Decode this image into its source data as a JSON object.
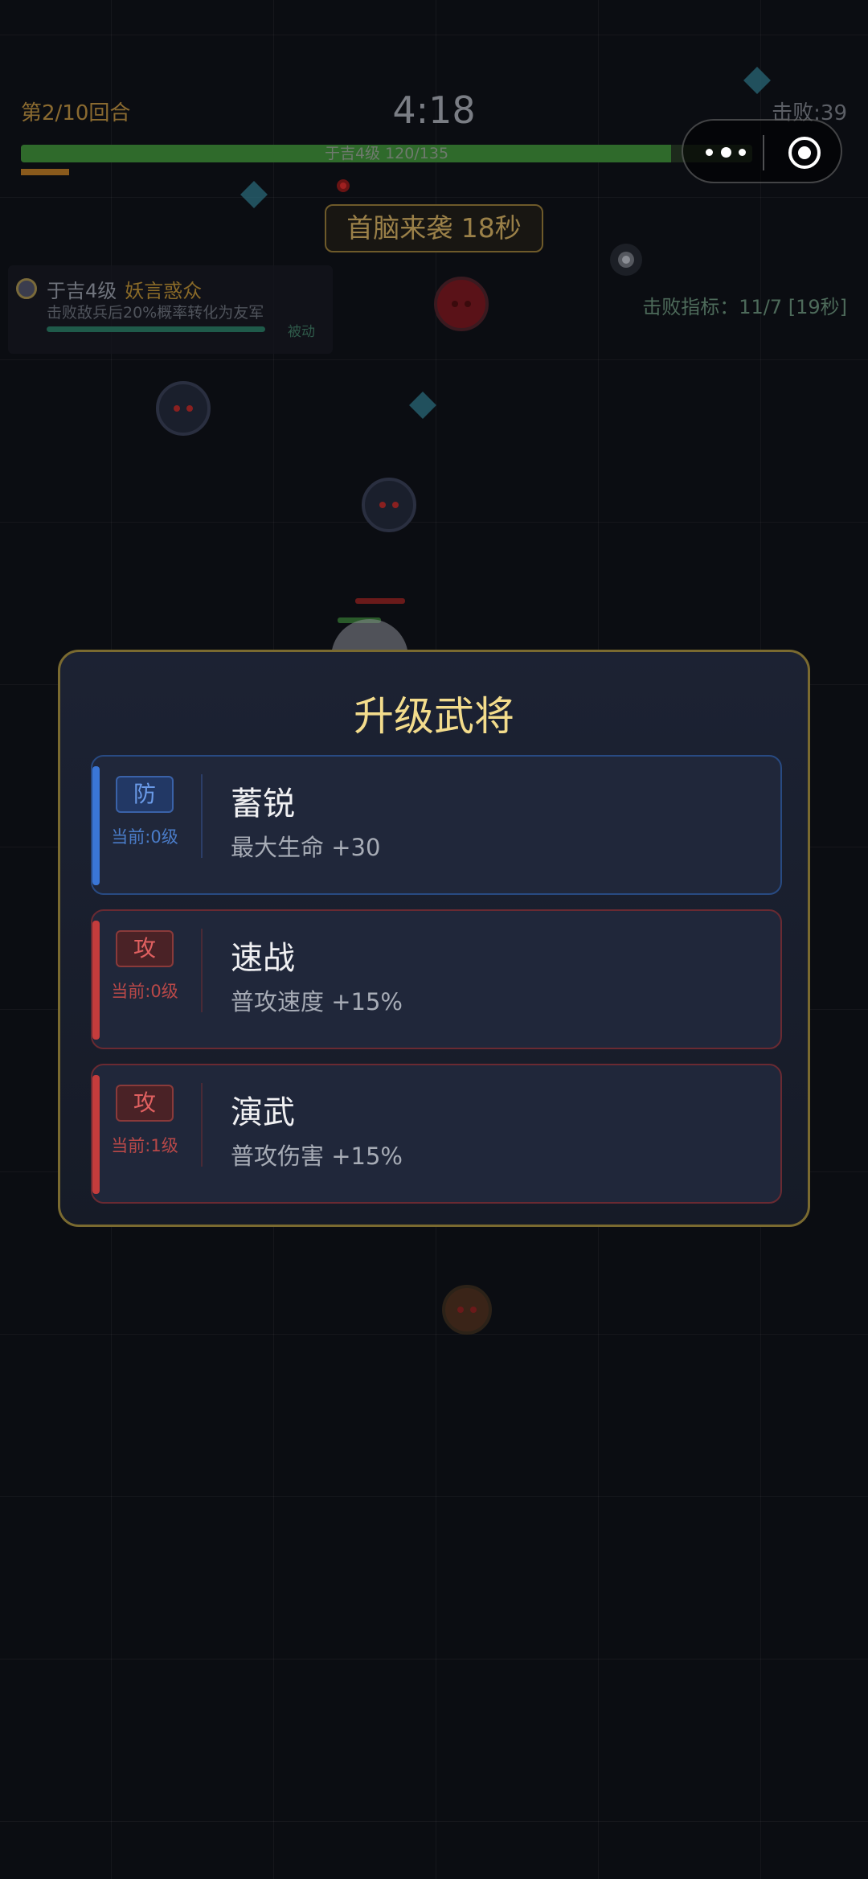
{
  "hud": {
    "round": "第2/10回合",
    "timer": "4:18",
    "kills": "击败:39",
    "hp_text": "于吉4级  120/135",
    "hp_fraction": 0.889,
    "boss_warning": "首脑来袭 18秒",
    "kill_target": "击败指标：11/7 [19秒]"
  },
  "skill": {
    "hero": "于吉4级",
    "name": "妖言惑众",
    "desc": "击败敌兵后20%概率转化为友军",
    "tag": "被动"
  },
  "modal": {
    "title": "升级武将",
    "cards": [
      {
        "type": "def",
        "badge": "防",
        "level": "当前:0级",
        "name": "蓄锐",
        "desc": "最大生命 +30"
      },
      {
        "type": "atk",
        "badge": "攻",
        "level": "当前:0级",
        "name": "速战",
        "desc": "普攻速度 +15%"
      },
      {
        "type": "atk",
        "badge": "攻",
        "level": "当前:1级",
        "name": "演武",
        "desc": "普攻伤害 +15%"
      }
    ]
  },
  "icons": {
    "capsule_more": "more-dots-icon",
    "capsule_close": "target-close-icon"
  },
  "colors": {
    "accent_gold": "#f3dc8c",
    "defense_blue": "#3a76d6",
    "attack_red": "#c43c3c"
  }
}
